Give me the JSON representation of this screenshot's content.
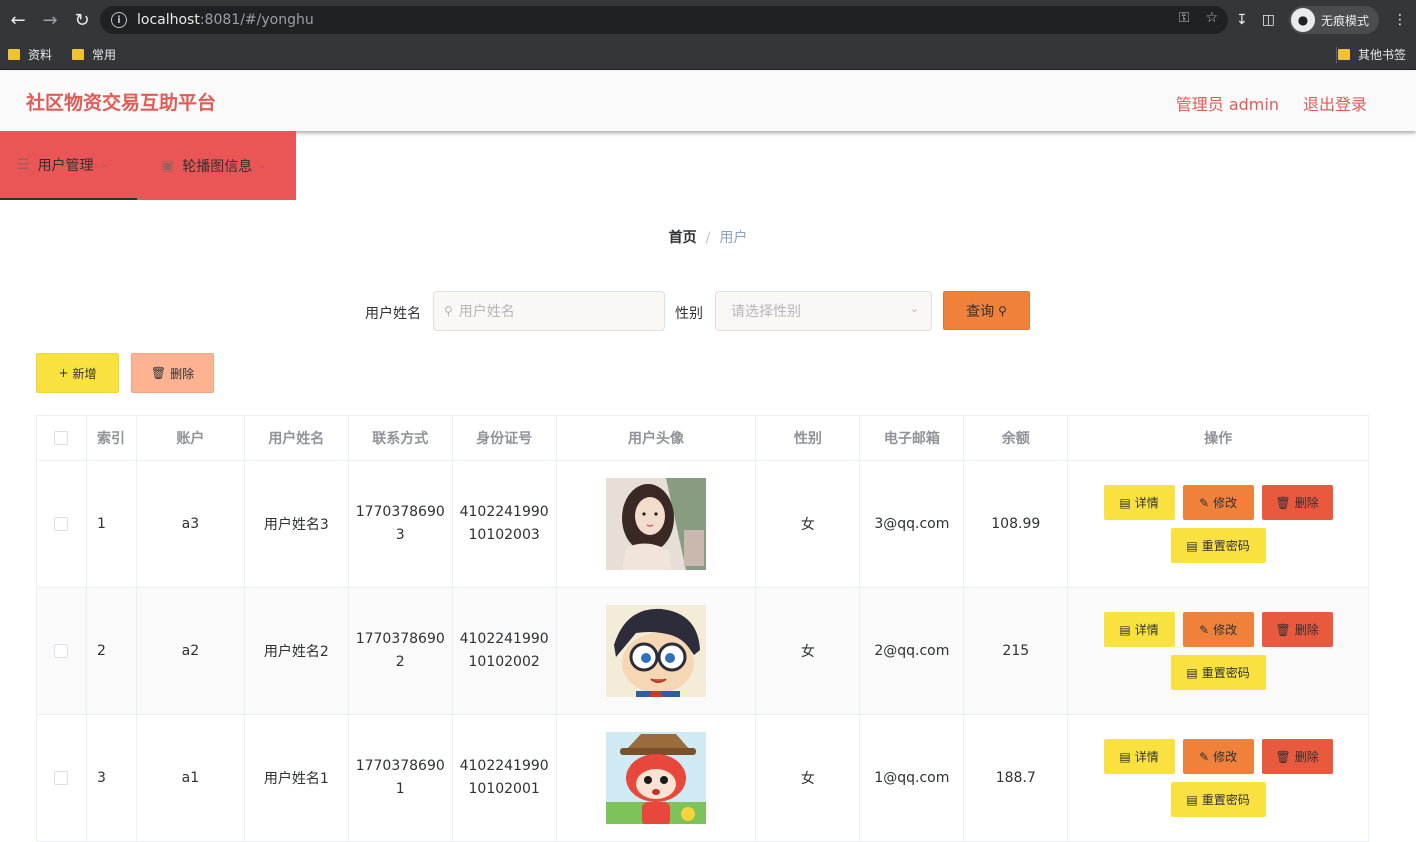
{
  "browser": {
    "url_host": "localhost",
    "url_rest": ":8081/#/yonghu",
    "incognito_label": "无痕模式",
    "bookmarks": [
      "资料",
      "常用"
    ],
    "other_bookmarks": "其他书签"
  },
  "header": {
    "title": "社区物资交易互助平台",
    "user_label": "管理员 admin",
    "logout_label": "退出登录"
  },
  "menu": {
    "items": [
      {
        "label": "用户管理",
        "icon": "menu-icon"
      },
      {
        "label": "轮播图信息",
        "icon": "monitor-icon"
      }
    ]
  },
  "breadcrumb": {
    "home": "首页",
    "separator": "/",
    "current": "用户"
  },
  "search": {
    "name_label": "用户姓名",
    "name_placeholder": "用户姓名",
    "gender_label": "性别",
    "gender_placeholder": "请选择性别",
    "query_label": "查询"
  },
  "actions": {
    "add_label": "新增",
    "delete_label": "删除"
  },
  "table": {
    "columns": [
      "",
      "索引",
      "账户",
      "用户姓名",
      "联系方式",
      "身份证号",
      "用户头像",
      "性别",
      "电子邮箱",
      "余额",
      "操作"
    ],
    "rows": [
      {
        "index": "1",
        "account": "a3",
        "name": "用户姓名3",
        "phone": "17703786903",
        "id_card": "410224199010102003",
        "avatar": "avatar-girl",
        "gender": "女",
        "email": "3@qq.com",
        "balance": "108.99"
      },
      {
        "index": "2",
        "account": "a2",
        "name": "用户姓名2",
        "phone": "17703786902",
        "id_card": "410224199010102002",
        "avatar": "avatar-conan",
        "gender": "女",
        "email": "2@qq.com",
        "balance": "215"
      },
      {
        "index": "3",
        "account": "a1",
        "name": "用户姓名1",
        "phone": "17703786901",
        "id_card": "410224199010102001",
        "avatar": "avatar-fox",
        "gender": "女",
        "email": "1@qq.com",
        "balance": "188.7"
      }
    ],
    "op_labels": {
      "detail": "详情",
      "edit": "修改",
      "delete": "删除",
      "reset": "重置密码"
    }
  },
  "colors": {
    "brand": "#e15c57",
    "menu_bg": "#ea5656",
    "yellow": "#f9e23f",
    "orange": "#f0813a",
    "red": "#e8593e"
  }
}
